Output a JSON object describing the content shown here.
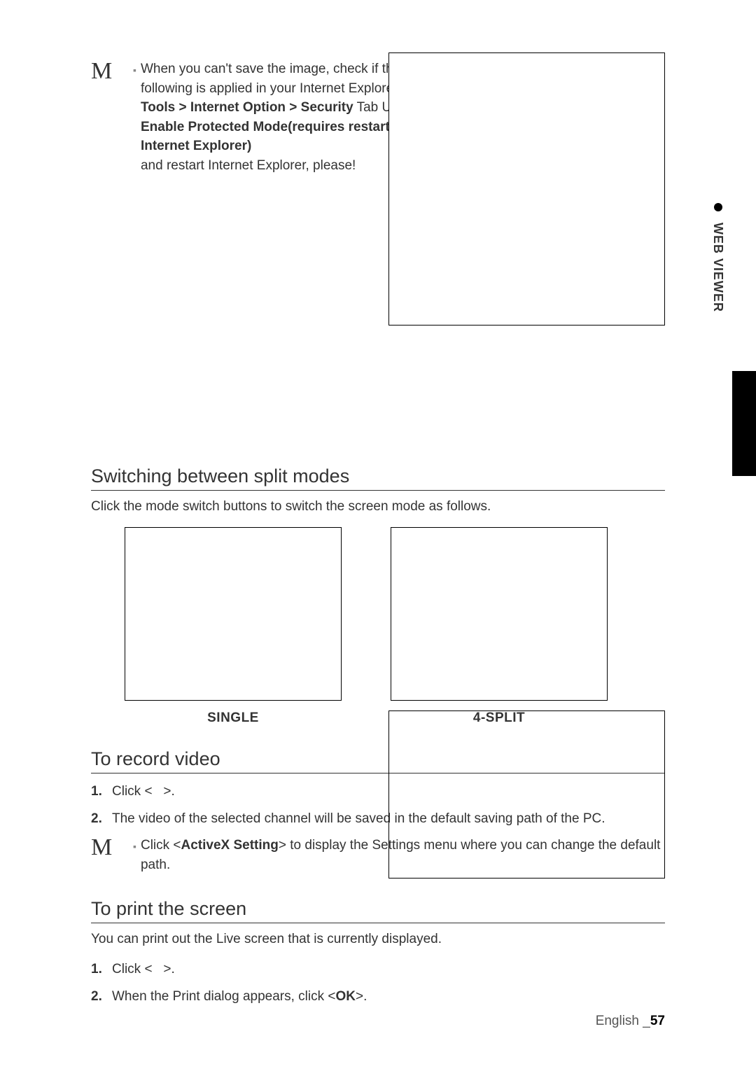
{
  "side_label": "WEB VIEWER",
  "top_note": {
    "line1": "When you can't save the image, check if the following is applied in your Internet Explorer.",
    "path_prefix": "Tools > Internet Option > Security",
    "path_mid": " Tab Uncheck ",
    "path_bold2": "Enable Protected Mode(requires restarting Internet Explorer)",
    "line3": "and restart Internet Explorer, please!"
  },
  "switch": {
    "title": "Switching between split modes",
    "desc": "Click the mode switch buttons to switch the screen mode as follows.",
    "mode1": "SINGLE",
    "mode2": "4-SPLIT"
  },
  "record": {
    "title": "To record video",
    "step1_a": "Click <",
    "step1_b": ">.",
    "step2": "The video of the selected channel will be saved in the default saving path of the PC.",
    "note_a": "Click <",
    "note_bold": "ActiveX Setting",
    "note_b": "> to display the Settings menu where you can change the default path."
  },
  "print": {
    "title": "To print the screen",
    "desc": "You can print out the Live screen that is currently displayed.",
    "step1_a": "Click <",
    "step1_b": ">.",
    "step2_a": "When the Print dialog appears, click <",
    "step2_bold": "OK",
    "step2_b": ">."
  },
  "footer": {
    "lang": "English _",
    "page": "57"
  }
}
